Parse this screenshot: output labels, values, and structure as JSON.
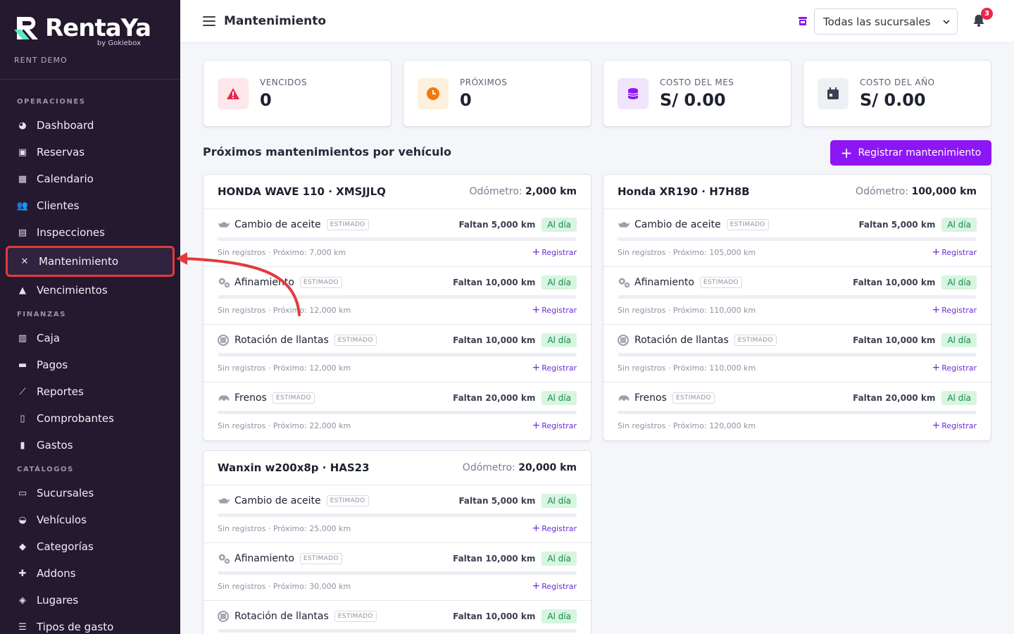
{
  "brand": {
    "name": "RentaYa",
    "by": "by Gokiebox",
    "company": "RENT DEMO"
  },
  "sidebar": {
    "sections": [
      {
        "title": "OPERACIONES",
        "items": [
          {
            "label": "Dashboard",
            "icon": "dashboard-icon"
          },
          {
            "label": "Reservas",
            "icon": "calendar-check-icon"
          },
          {
            "label": "Calendario",
            "icon": "calendar-icon"
          },
          {
            "label": "Clientes",
            "icon": "users-icon"
          },
          {
            "label": "Inspecciones",
            "icon": "clipboard-check-icon"
          },
          {
            "label": "Mantenimiento",
            "icon": "tools-icon",
            "active": true
          },
          {
            "label": "Vencimientos",
            "icon": "bell-icon"
          }
        ]
      },
      {
        "title": "FINANZAS",
        "items": [
          {
            "label": "Caja",
            "icon": "cash-register-icon"
          },
          {
            "label": "Pagos",
            "icon": "credit-card-icon"
          },
          {
            "label": "Reportes",
            "icon": "chart-line-icon"
          },
          {
            "label": "Comprobantes",
            "icon": "receipt-icon"
          },
          {
            "label": "Gastos",
            "icon": "file-invoice-icon"
          }
        ]
      },
      {
        "title": "CATÁLOGOS",
        "items": [
          {
            "label": "Sucursales",
            "icon": "store-icon"
          },
          {
            "label": "Vehículos",
            "icon": "car-icon"
          },
          {
            "label": "Categorías",
            "icon": "tags-icon"
          },
          {
            "label": "Addons",
            "icon": "puzzle-icon"
          },
          {
            "label": "Lugares",
            "icon": "map-marker-icon"
          },
          {
            "label": "Tipos de gasto",
            "icon": "list-icon"
          }
        ]
      }
    ]
  },
  "topbar": {
    "title": "Mantenimiento",
    "branch_select": "Todas las sucursales",
    "notifications": "3"
  },
  "stats": [
    {
      "label": "VENCIDOS",
      "value": "0",
      "icon": "warning-triangle-icon",
      "color": "#e8294b",
      "bg": "#fde7ea"
    },
    {
      "label": "PRÓXIMOS",
      "value": "0",
      "icon": "clock-icon",
      "color": "#f07a10",
      "bg": "#fdf0dc"
    },
    {
      "label": "COSTO DEL MES",
      "value": "S/ 0.00",
      "icon": "coins-icon",
      "color": "#8d16f4",
      "bg": "#f1e4fd"
    },
    {
      "label": "COSTO DEL AÑO",
      "value": "S/ 0.00",
      "icon": "calendar-icon",
      "color": "#3c4050",
      "bg": "#eef0f4"
    }
  ],
  "section_title": "Próximos mantenimientos por vehículo",
  "register_button": "Registrar mantenimiento",
  "odometer_label": "Odómetro:",
  "estimated_label": "ESTIMADO",
  "status_label": "Al día",
  "register_link": "Registrar",
  "vehicles": [
    {
      "name": "HONDA WAVE 110 · XMSJJLQ",
      "odometer": "2,000 km",
      "items": [
        {
          "name": "Cambio de aceite",
          "icon": "oil-can-icon",
          "remaining": "Faltan 5,000 km",
          "info": "Sin registros · Próximo: 7,000 km"
        },
        {
          "name": "Afinamiento",
          "icon": "cogs-icon",
          "remaining": "Faltan 10,000 km",
          "info": "Sin registros · Próximo: 12,000 km"
        },
        {
          "name": "Rotación de llantas",
          "icon": "tire-icon",
          "remaining": "Faltan 10,000 km",
          "info": "Sin registros · Próximo: 12,000 km"
        },
        {
          "name": "Frenos",
          "icon": "brake-icon",
          "remaining": "Faltan 20,000 km",
          "info": "Sin registros · Próximo: 22,000 km"
        }
      ]
    },
    {
      "name": "Honda XR190 · H7H8B",
      "odometer": "100,000 km",
      "items": [
        {
          "name": "Cambio de aceite",
          "icon": "oil-can-icon",
          "remaining": "Faltan 5,000 km",
          "info": "Sin registros · Próximo: 105,000 km"
        },
        {
          "name": "Afinamiento",
          "icon": "cogs-icon",
          "remaining": "Faltan 10,000 km",
          "info": "Sin registros · Próximo: 110,000 km"
        },
        {
          "name": "Rotación de llantas",
          "icon": "tire-icon",
          "remaining": "Faltan 10,000 km",
          "info": "Sin registros · Próximo: 110,000 km"
        },
        {
          "name": "Frenos",
          "icon": "brake-icon",
          "remaining": "Faltan 20,000 km",
          "info": "Sin registros · Próximo: 120,000 km"
        }
      ]
    },
    {
      "name": "Wanxin w200x8p · HAS23",
      "odometer": "20,000 km",
      "items": [
        {
          "name": "Cambio de aceite",
          "icon": "oil-can-icon",
          "remaining": "Faltan 5,000 km",
          "info": "Sin registros · Próximo: 25,000 km"
        },
        {
          "name": "Afinamiento",
          "icon": "cogs-icon",
          "remaining": "Faltan 10,000 km",
          "info": "Sin registros · Próximo: 30,000 km"
        },
        {
          "name": "Rotación de llantas",
          "icon": "tire-icon",
          "remaining": "Faltan 10,000 km",
          "info": ""
        }
      ]
    }
  ],
  "colors": {
    "sidebar_bg": "#24192f",
    "accent": "#8d16f4",
    "highlight": "#e23b3b",
    "ok_text": "#16884b",
    "ok_bg": "#d7f5e1"
  }
}
